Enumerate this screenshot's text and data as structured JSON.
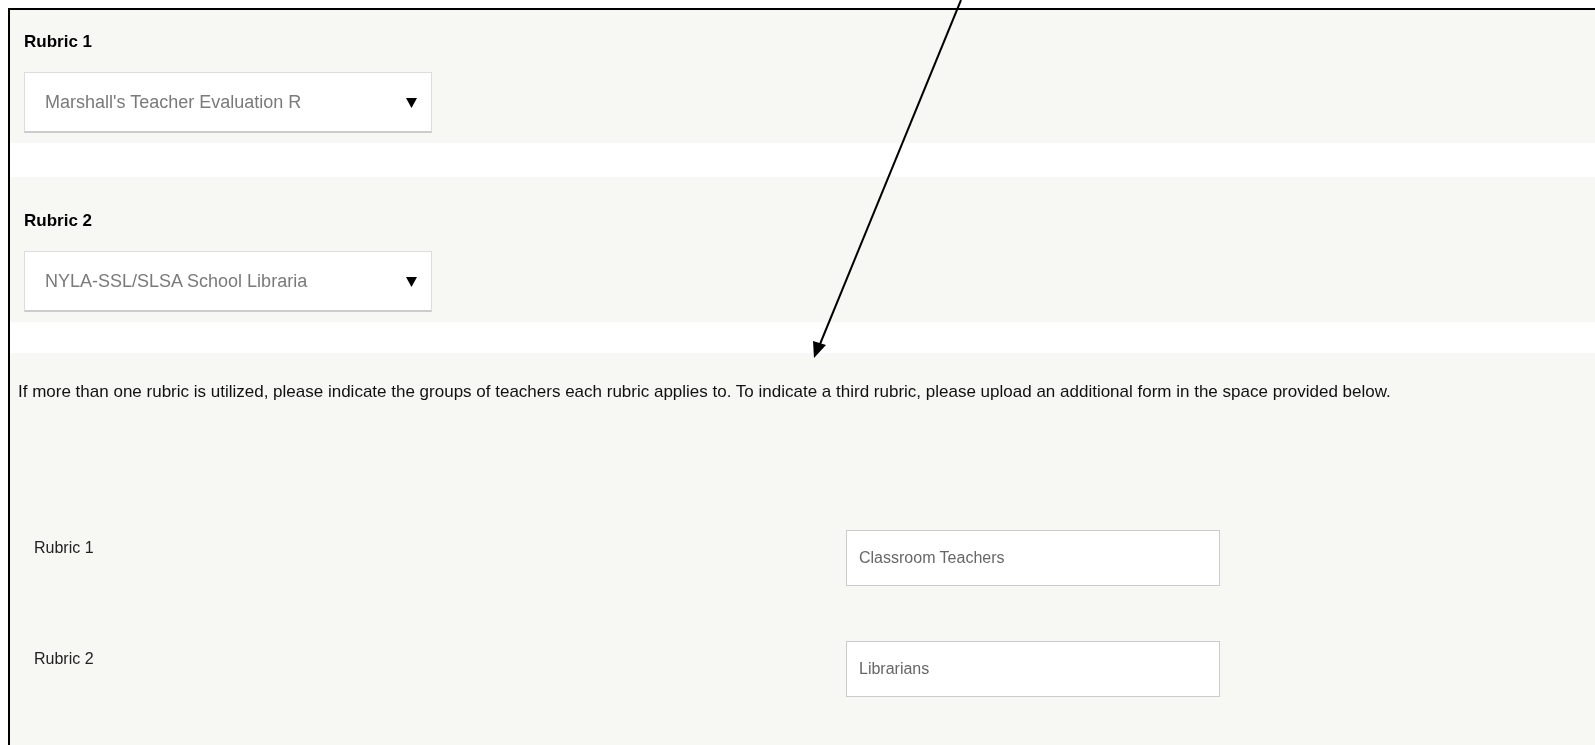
{
  "sections": [
    {
      "heading": "Rubric 1",
      "select": {
        "value": "Marshall's Teacher Evaluation R"
      }
    },
    {
      "heading": "Rubric 2",
      "select": {
        "value": "NYLA-SSL/SLSA School Libraria"
      }
    }
  ],
  "instructions": "If more than one rubric is utilized, please indicate the groups of teachers each rubric applies to. To indicate a third rubric, please upload an additional form in the space provided below.",
  "assignments": [
    {
      "label": "Rubric 1",
      "value": "Classroom Teachers"
    },
    {
      "label": "Rubric 2",
      "value": "Librarians"
    }
  ]
}
